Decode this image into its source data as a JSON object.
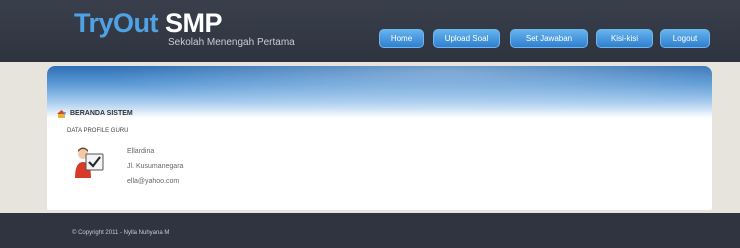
{
  "header": {
    "logo_primary": "TryOut",
    "logo_secondary": "SMP",
    "tagline": "Sekolah Menengah Pertama"
  },
  "nav": {
    "items": [
      {
        "label": "Home"
      },
      {
        "label": "Upload Soal"
      },
      {
        "label": "Set Jawaban"
      },
      {
        "label": "Kisi-kisi"
      },
      {
        "label": "Logout"
      }
    ]
  },
  "content": {
    "section_title": "BERANDA SISTEM",
    "subtitle": "DATA PROFILE GURU",
    "profile": {
      "name": "Ellardina",
      "address": "Jl. Kusumanegara",
      "email": "ella@yahoo.com"
    }
  },
  "footer": {
    "copyright": "© Copyright 2011 - Nylla Nuhyana M"
  },
  "colors": {
    "header_bg": "#2e3340",
    "accent_blue": "#4fa3e4",
    "nav_button": "#3d8fd8",
    "page_bg": "#e6e4dc"
  }
}
